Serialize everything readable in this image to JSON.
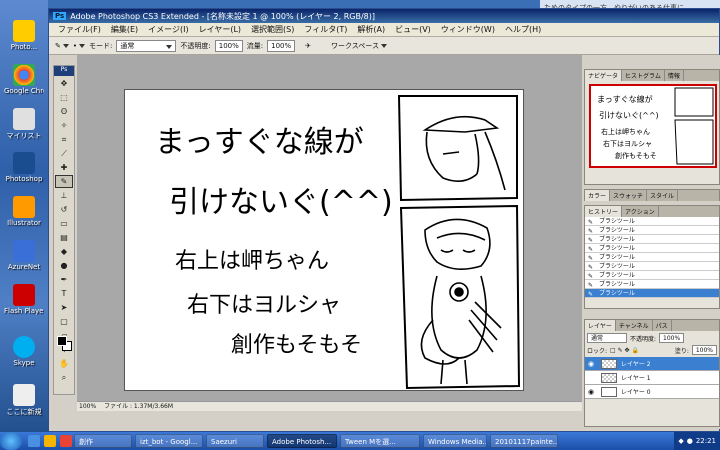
{
  "desktop": {
    "icons": [
      {
        "label": "Photo..."
      },
      {
        "label": "Google Chrome"
      },
      {
        "label": "マイリスト"
      },
      {
        "label": "Photoshop"
      },
      {
        "label": "Illustrator"
      },
      {
        "label": "AzureNet"
      },
      {
        "label": "Flash Player"
      },
      {
        "label": "Skype"
      },
      {
        "label": "ここに新規"
      }
    ]
  },
  "bg_window_text": "ためのタイプの一方、やりがいのある仕事に",
  "window": {
    "title": "Adobe Photoshop CS3 Extended - [名称未設定 1 @ 100% (レイヤー 2, RGB/8)]",
    "badge": "Ps"
  },
  "menu": [
    "ファイル(F)",
    "編集(E)",
    "イメージ(I)",
    "レイヤー(L)",
    "選択範囲(S)",
    "フィルタ(T)",
    "解析(A)",
    "ビュー(V)",
    "ウィンドウ(W)",
    "ヘルプ(H)"
  ],
  "options": {
    "mode_label": "モード:",
    "mode_value": "通常",
    "opacity_label": "不透明度:",
    "opacity_value": "100%",
    "flow_label": "流量:",
    "flow_value": "100%",
    "workspace_label": "ワークスペース"
  },
  "canvas_text": {
    "line1": "まっすぐな線が",
    "line2": "引けないぐ(^^)",
    "line3": "右上は岬ちゃん",
    "line4": "右下はヨルシャ",
    "line5": "創作もそもそ"
  },
  "statusbar": {
    "zoom": "100%",
    "file": "ファイル : 1.37M/3.66M"
  },
  "navigator": {
    "tabs": [
      "ナビゲータ",
      "ヒストグラム",
      "情報"
    ]
  },
  "color_panel": {
    "tabs": [
      "カラー",
      "スウォッチ",
      "スタイル"
    ]
  },
  "history": {
    "tabs": [
      "ヒストリー",
      "アクション"
    ],
    "items": [
      "ブラシツール",
      "ブラシツール",
      "ブラシツール",
      "ブラシツール",
      "ブラシツール",
      "ブラシツール",
      "ブラシツール",
      "ブラシツール",
      "ブラシツール"
    ]
  },
  "layers": {
    "tabs": [
      "レイヤー",
      "チャンネル",
      "パス"
    ],
    "blend": "通常",
    "opacity_label": "不透明度:",
    "opacity_value": "100%",
    "lock_label": "ロック:",
    "fill_label": "塗り:",
    "fill_value": "100%",
    "items": [
      {
        "name": "レイヤー 2",
        "selected": true
      },
      {
        "name": "レイヤー 1",
        "selected": false
      },
      {
        "name": "レイヤー 0",
        "selected": false
      }
    ]
  },
  "taskbar": {
    "tasks": [
      "創作",
      "izt_bot - Googl...",
      "Saezuri",
      "Adobe Photosh...",
      "Tween  Mを選...",
      "Windows Media...",
      "20101117painte..."
    ],
    "clock": "22:21"
  }
}
